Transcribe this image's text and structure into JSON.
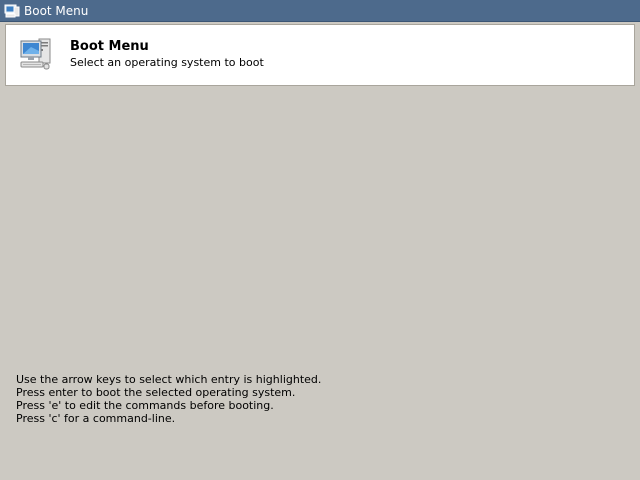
{
  "window": {
    "title": "Boot Menu",
    "icon": "computer-icon"
  },
  "header": {
    "title": "Boot Menu",
    "subtitle": "Select an operating system to boot",
    "icon": "computer-icon"
  },
  "instructions": [
    "Use the arrow keys to select which entry is highlighted.",
    "Press enter to boot the selected operating system.",
    "Press 'e' to edit the commands before booting.",
    "Press 'c' for a command-line."
  ],
  "colors": {
    "titlebar": "#4d6a8c",
    "background": "#ccc9c2",
    "panel": "#ffffff"
  }
}
